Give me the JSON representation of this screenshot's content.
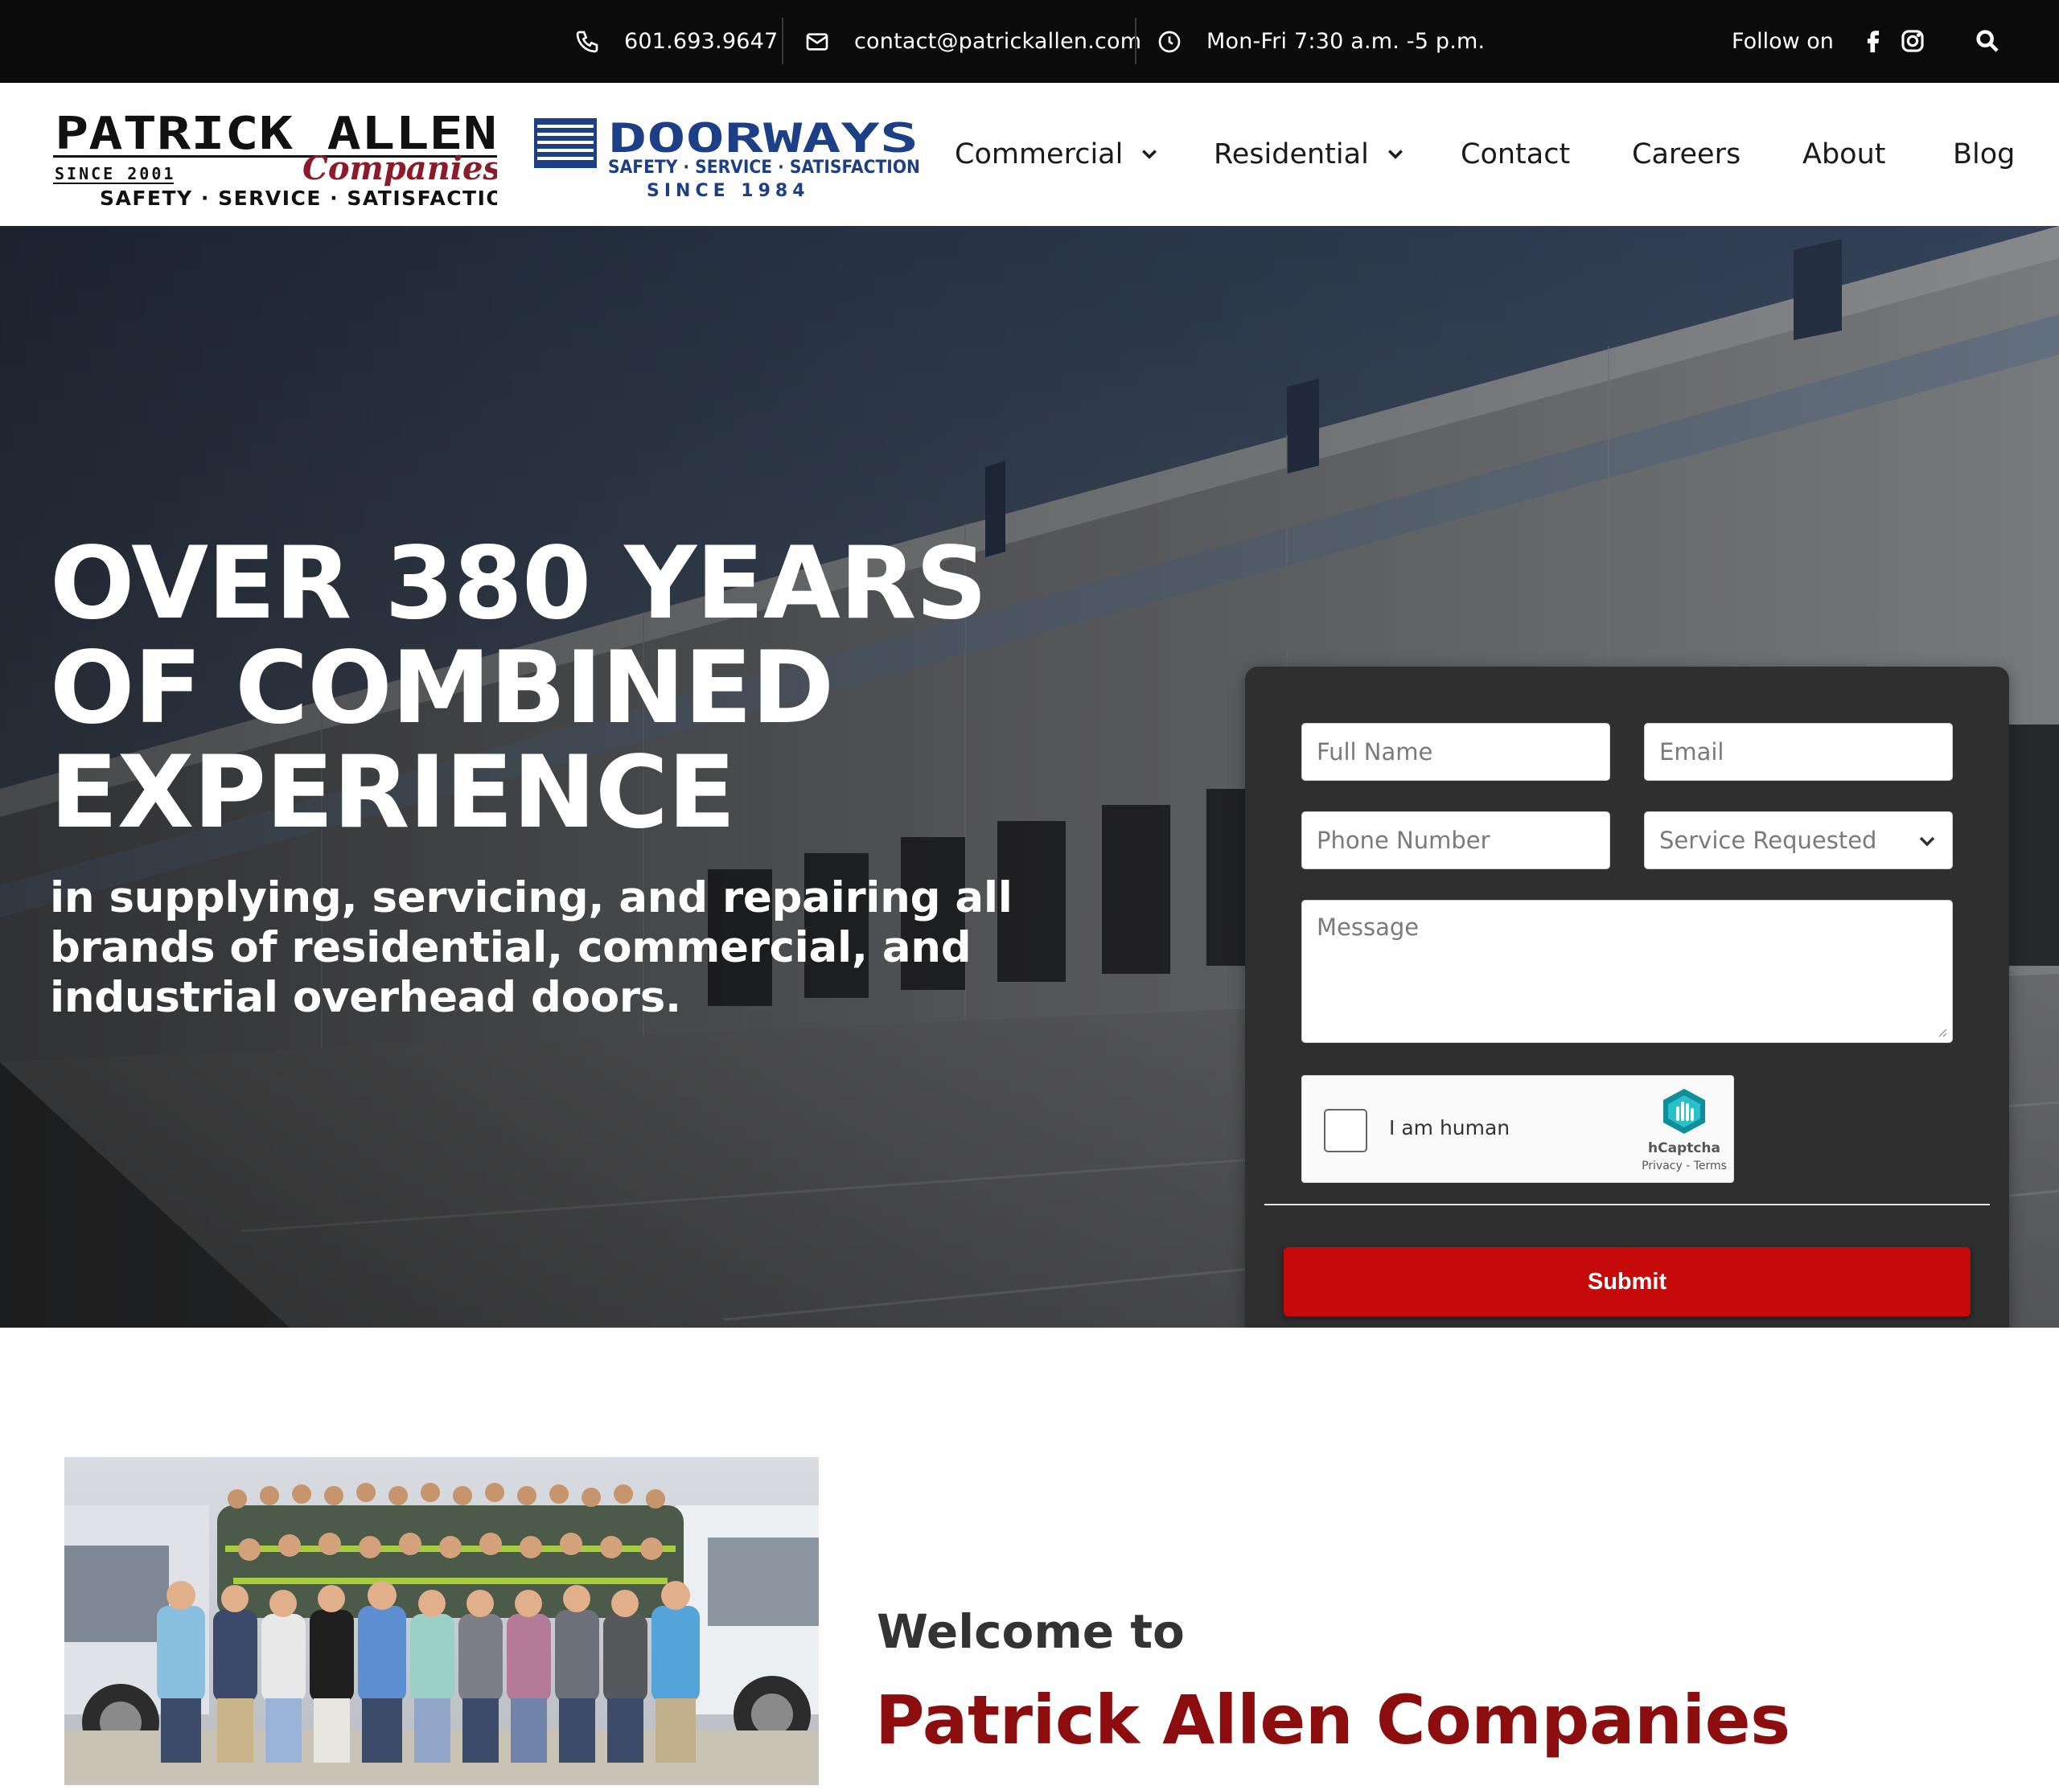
{
  "topbar": {
    "phone": "601.693.9647",
    "email": "contact@patrickallen.com",
    "hours": "Mon-Fri 7:30 a.m. -5 p.m.",
    "follow_label": "Follow on",
    "social": [
      "facebook-icon",
      "instagram-icon"
    ],
    "search_icon": "search-icon"
  },
  "logos": {
    "patrick_allen": {
      "line1": "PATRICK ALLEN",
      "companies": "Companies",
      "since": "SINCE 2001",
      "tagline": "Safety · Service · Satisfaction"
    },
    "doorways": {
      "name": "DOORWAYS",
      "tagline": "Safety · Service · Satisfaction",
      "since": "SINCE 1984"
    }
  },
  "nav": {
    "items": [
      {
        "label": "Commercial",
        "dropdown": true
      },
      {
        "label": "Residential",
        "dropdown": true
      },
      {
        "label": "Contact",
        "dropdown": false
      },
      {
        "label": "Careers",
        "dropdown": false
      },
      {
        "label": "About",
        "dropdown": false
      },
      {
        "label": "Blog",
        "dropdown": false
      }
    ]
  },
  "hero": {
    "title": "OVER 380 YEARS OF COMBINED EXPERIENCE",
    "subtitle": "in supplying, servicing, and repairing all brands of residential, commercial, and industrial overhead doors."
  },
  "form": {
    "full_name_placeholder": "Full Name",
    "email_placeholder": "Email",
    "phone_placeholder": "Phone Number",
    "service_placeholder": "Service Requested",
    "message_placeholder": "Message",
    "captcha_label": "I am human",
    "captcha_brand": "hCaptcha",
    "captcha_links": "Privacy - Terms",
    "submit_label": "Submit"
  },
  "welcome": {
    "pre": "Welcome to",
    "main": "Patrick Allen Companies"
  },
  "colors": {
    "topbar_bg": "#0b0b0b",
    "brand_red": "#8b0d0d",
    "submit_red": "#c60a0a",
    "doorways_blue": "#1d3f85",
    "form_card": "#2f2f30"
  }
}
